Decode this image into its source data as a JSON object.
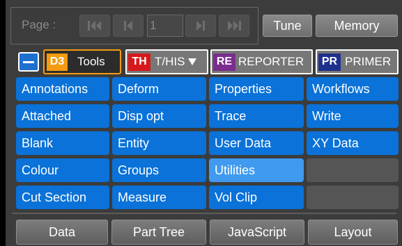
{
  "pager": {
    "label": "Page :",
    "value": "1",
    "first_icon": "skip-first-icon",
    "prev_icon": "step-back-icon",
    "next_icon": "step-forward-icon",
    "last_icon": "skip-last-icon"
  },
  "top_buttons": {
    "tune": "Tune",
    "memory": "Memory"
  },
  "tabs": {
    "collapse_icon": "minus-icon",
    "tools": {
      "logo": "D3",
      "label": "Tools",
      "color": "#f39c12"
    },
    "this": {
      "logo": "TH",
      "label": "T/HIS",
      "color": "#d7191c",
      "dropdown_icon": "triangle-down-icon"
    },
    "reporter": {
      "logo": "RE",
      "label": "REPORTER",
      "color": "#7b2d8e"
    },
    "primer": {
      "logo": "PR",
      "label": "PRIMER",
      "color": "#1e2f8c"
    }
  },
  "grid": {
    "col1": [
      "Annotations",
      "Attached",
      "Blank",
      "Colour",
      "Cut Section"
    ],
    "col2": [
      "Deform",
      "Disp opt",
      "Entity",
      "Groups",
      "Measure"
    ],
    "col3": [
      "Properties",
      "Trace",
      "User Data",
      "Utilities",
      "Vol Clip"
    ],
    "col4": [
      "Workflows",
      "Write",
      "XY Data",
      "",
      ""
    ],
    "active": "Utilities"
  },
  "bottom_buttons": [
    "Data",
    "Part Tree",
    "JavaScript",
    "Layout"
  ],
  "colors": {
    "button_blue": "#0a72d8",
    "button_active": "#3f9af0",
    "panel_bg": "#3c3c3c"
  }
}
